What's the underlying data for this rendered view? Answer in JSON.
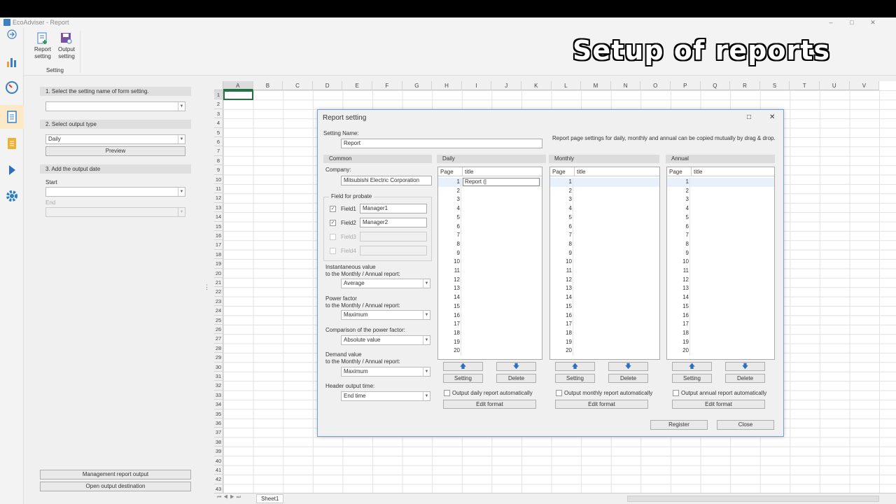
{
  "window": {
    "title": "EcoAdviser - Report",
    "min": "–",
    "max": "□",
    "close": "✕"
  },
  "overlay_caption": "Setup of reports",
  "ribbon": {
    "report_setting": "Report setting",
    "output_setting": "Output setting",
    "group_label": "Setting"
  },
  "nav": [
    "back-icon",
    "chart-icon",
    "gauge-icon",
    "report-icon",
    "document-icon",
    "play-icon",
    "gear-icon"
  ],
  "left": {
    "step1": "1. Select the setting name of form setting.",
    "step1_value": "",
    "step2": "2. Select output type",
    "step2_value": "Daily",
    "preview": "Preview",
    "step3": "3. Add the output date",
    "start_label": "Start",
    "start_value": "",
    "end_label": "End",
    "end_value": "",
    "mgmt_btn": "Management report output",
    "open_btn": "Open output destination"
  },
  "sheet": {
    "columns": [
      "A",
      "B",
      "C",
      "D",
      "E",
      "F",
      "G",
      "H",
      "I",
      "J",
      "K",
      "L",
      "M",
      "N",
      "O",
      "P",
      "Q",
      "R",
      "S",
      "T",
      "U",
      "V"
    ],
    "rows": [
      "1",
      "2",
      "3",
      "4",
      "5",
      "6",
      "7",
      "8",
      "9",
      "10",
      "11",
      "12",
      "13",
      "14",
      "15",
      "16",
      "17",
      "18",
      "19",
      "20",
      "21",
      "22",
      "23",
      "24",
      "25",
      "26",
      "27",
      "28",
      "29",
      "30",
      "31",
      "32",
      "33",
      "34",
      "35",
      "36",
      "37",
      "38",
      "39",
      "40",
      "41",
      "42",
      "43"
    ],
    "tab": "Sheet1"
  },
  "dialog": {
    "title": "Report setting",
    "max_icon": "□",
    "close_icon": "✕",
    "setting_name_label": "Setting Name:",
    "setting_name_value": "Report",
    "note": "Report page settings for daily, monthly and annual can be copied mutually by drag & drop.",
    "common": "Common",
    "company_label": "Company:",
    "company_value": "Mitsubishi Electric Corporation",
    "probate_group": "Field for probate",
    "fields": [
      {
        "label": "Field1",
        "value": "Manager1",
        "checked": "✓"
      },
      {
        "label": "Field2",
        "value": "Manager2",
        "checked": "✓"
      },
      {
        "label": "Field3",
        "value": "",
        "checked": ""
      },
      {
        "label": "Field4",
        "value": "",
        "checked": ""
      }
    ],
    "inst_label1": "Instantaneous value",
    "inst_label2": "to the Monthly / Annual report:",
    "inst_value": "Average",
    "pf_label1": "Power factor",
    "pf_label2": "to the Monthly / Annual report:",
    "pf_value": "Maximum",
    "cmp_label": "Comparison of the power factor:",
    "cmp_value": "Absolute value",
    "dem_label1": "Demand value",
    "dem_label2": "to the Monthly / Annual report:",
    "dem_value": "Maximum",
    "hdr_label": "Header output time:",
    "hdr_value": "End time",
    "panels": [
      {
        "name": "Daily",
        "page": "Page",
        "title": "title",
        "first_title": "Report (|",
        "auto": "Output daily report automatically"
      },
      {
        "name": "Monthly",
        "page": "Page",
        "title": "title",
        "first_title": "",
        "auto": "Output monthly report automatically"
      },
      {
        "name": "Annual",
        "page": "Page",
        "title": "title",
        "first_title": "",
        "auto": "Output annual report automatically"
      }
    ],
    "pages": [
      "1",
      "2",
      "3",
      "4",
      "5",
      "6",
      "7",
      "8",
      "9",
      "10",
      "11",
      "12",
      "13",
      "14",
      "15",
      "16",
      "17",
      "18",
      "19",
      "20"
    ],
    "up_icon": "🡅",
    "down_icon": "🡇",
    "setting_btn": "Setting",
    "delete_btn": "Delete",
    "edit_format": "Edit format",
    "register": "Register",
    "close": "Close"
  }
}
